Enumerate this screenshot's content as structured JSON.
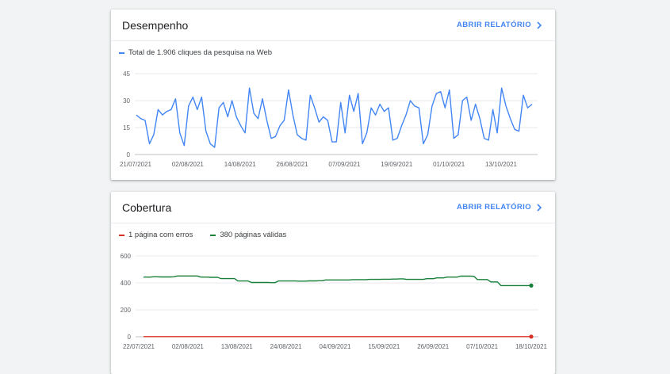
{
  "performance": {
    "title": "Desempenho",
    "report_link": "ABRIR RELATÓRIO",
    "legend": [
      {
        "label": "Total de 1.906 cliques da pesquisa na Web",
        "color": "#4285f4"
      }
    ]
  },
  "coverage": {
    "title": "Cobertura",
    "report_link": "ABRIR RELATÓRIO",
    "legend": [
      {
        "label": "1 página com erros",
        "color": "#d93025"
      },
      {
        "label": "380 páginas válidas",
        "color": "#188038"
      }
    ]
  },
  "chart_data": [
    {
      "type": "line",
      "ylim": [
        0,
        45
      ],
      "yticks": [
        "0",
        "15",
        "30",
        "45"
      ],
      "xticks": [
        "21/07/2021",
        "02/08/2021",
        "14/08/2021",
        "26/08/2021",
        "07/09/2021",
        "19/09/2021",
        "01/10/2021",
        "13/10/2021"
      ],
      "grid": true,
      "series": [
        {
          "color": "#4285f4",
          "values": [
            22,
            20,
            19,
            6,
            11,
            25,
            22,
            24,
            25,
            31,
            12,
            5,
            27,
            32,
            25,
            32,
            13,
            6,
            4,
            26,
            29,
            21,
            30,
            21,
            16,
            12,
            37,
            23,
            20,
            31,
            19,
            9,
            10,
            16,
            19,
            36,
            22,
            11,
            9,
            8,
            33,
            26,
            18,
            21,
            19,
            7,
            7,
            29,
            12,
            33,
            24,
            34,
            6,
            12,
            26,
            22,
            28,
            24,
            26,
            8,
            9,
            16,
            22,
            30,
            27,
            26,
            6,
            11,
            27,
            34,
            35,
            26,
            36,
            9,
            11,
            30,
            32,
            19,
            28,
            20,
            9,
            8,
            25,
            12,
            37,
            27,
            20,
            14,
            13,
            33,
            26,
            28
          ]
        }
      ]
    },
    {
      "type": "line",
      "ylim": [
        0,
        600
      ],
      "yticks": [
        "0",
        "200",
        "400",
        "600"
      ],
      "xticks": [
        "22/07/2021",
        "02/08/2021",
        "13/08/2021",
        "24/08/2021",
        "04/09/2021",
        "15/09/2021",
        "26/09/2021",
        "07/10/2021",
        "18/10/2021"
      ],
      "grid": true,
      "series": [
        {
          "name": "1 página com erros",
          "color": "#d93025",
          "values": [
            1,
            1,
            1,
            1,
            1,
            1,
            1,
            1,
            1,
            1,
            1,
            1,
            1,
            1,
            1,
            1,
            1,
            1,
            1,
            1,
            1,
            1,
            1,
            1,
            1,
            1,
            1,
            1,
            1,
            1,
            1,
            1,
            1,
            1,
            1,
            1,
            1,
            1,
            1,
            1,
            1,
            1,
            1,
            1,
            1,
            1,
            1,
            1,
            1,
            1,
            1,
            1,
            1,
            1,
            1,
            1,
            1,
            1,
            1,
            1,
            1,
            1,
            1,
            1,
            1,
            1,
            1,
            1,
            1,
            1,
            1,
            1,
            1,
            1,
            1,
            1,
            1,
            1,
            1,
            1,
            1,
            1,
            1,
            1,
            1,
            1,
            1,
            1,
            1
          ]
        },
        {
          "name": "380 páginas válidas",
          "color": "#188038",
          "values": [
            443,
            443,
            443,
            445,
            445,
            444,
            444,
            444,
            444,
            445,
            451,
            451,
            451,
            451,
            451,
            451,
            451,
            443,
            443,
            443,
            441,
            441,
            441,
            432,
            432,
            432,
            432,
            432,
            414,
            414,
            414,
            414,
            403,
            403,
            403,
            403,
            403,
            403,
            402,
            402,
            414,
            414,
            414,
            414,
            414,
            414,
            413,
            413,
            413,
            415,
            415,
            415,
            416,
            416,
            422,
            422,
            422,
            422,
            422,
            422,
            422,
            422,
            424,
            424,
            424,
            424,
            424,
            426,
            426,
            426,
            426,
            427,
            427,
            427,
            428,
            428,
            430,
            430,
            426,
            426,
            426,
            426,
            426,
            426,
            431,
            431,
            431,
            437,
            437,
            437,
            443,
            443,
            443,
            443,
            450,
            450,
            450,
            450,
            449,
            425,
            425,
            425,
            425,
            407,
            407,
            407,
            380,
            380,
            380,
            380,
            380,
            380,
            380,
            380,
            380,
            380
          ]
        }
      ]
    }
  ]
}
